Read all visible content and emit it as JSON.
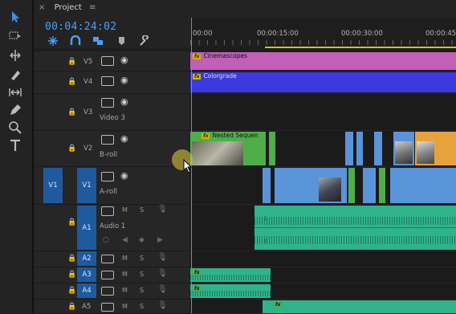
{
  "panel": {
    "close_glyph": "×",
    "title": "Project",
    "menu_glyph": "≡"
  },
  "timecode": "00:04:24:02",
  "ruler": {
    "labels": [
      "00:00",
      "00:00:15:00",
      "00:00:30:00",
      "00:00:45:"
    ]
  },
  "tracks": {
    "V5": {
      "label": "V5",
      "clip": "Cinemascopes"
    },
    "V4": {
      "label": "V4",
      "clip": "Colorgrade"
    },
    "V3": {
      "label": "V3",
      "name": "Video 3"
    },
    "V2": {
      "label": "V2",
      "name": "B-roll",
      "clip": "Nested Sequen"
    },
    "V1": {
      "label": "V1",
      "source": "V1",
      "name": "A-roll"
    },
    "A1": {
      "label": "A1",
      "name": "Audio 1"
    },
    "A2": {
      "label": "A2"
    },
    "A3": {
      "label": "A3"
    },
    "A4": {
      "label": "A4"
    },
    "A5": {
      "label": "A5"
    }
  },
  "audio_buttons": {
    "mute": "M",
    "solo": "S"
  },
  "clip_markers": {
    "fx": "fx",
    "left": "L",
    "right": "R"
  },
  "colors": {
    "timecode": "#4a9ff5",
    "v5_clip": "#c060b8",
    "v4_clip": "#3a3ae0",
    "nested": "#4fae4a",
    "video": "#5a94d8",
    "orange": "#e8a23c",
    "audio": "#2fb38a",
    "target": "#1f5a9e"
  }
}
